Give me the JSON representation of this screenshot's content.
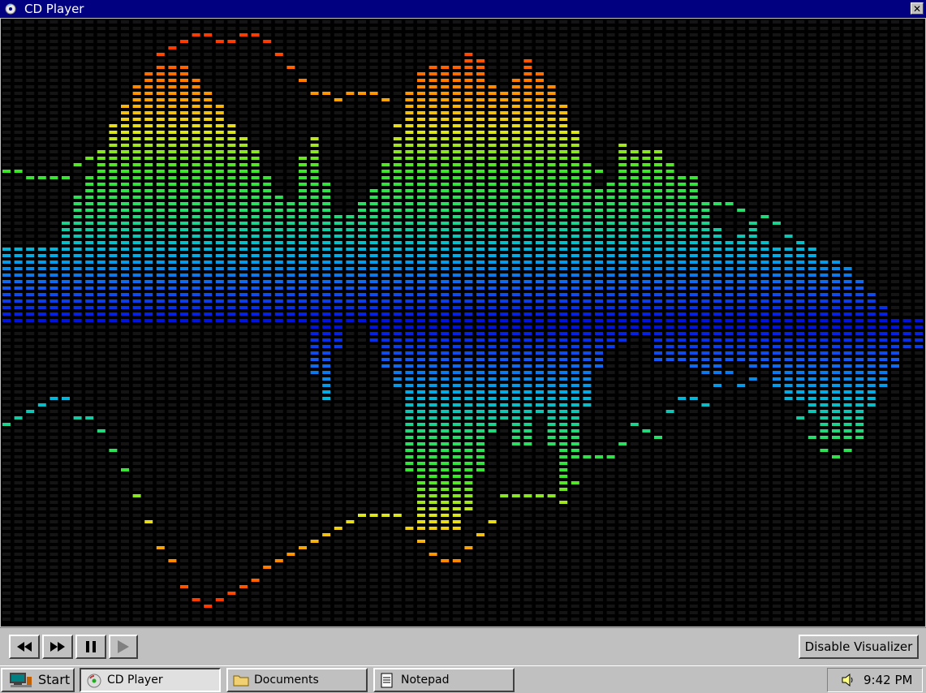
{
  "window": {
    "title": "CD Player"
  },
  "controls": {
    "disable_visualizer_label": "Disable Visualizer"
  },
  "taskbar": {
    "start_label": "Start",
    "items": [
      {
        "label": "CD Player",
        "active": true
      },
      {
        "label": "Documents",
        "active": false
      },
      {
        "label": "Notepad",
        "active": false
      }
    ],
    "clock": "9:42 PM"
  },
  "visualizer": {
    "bar_levels_up": [
      0.28,
      0.27,
      0.27,
      0.27,
      0.27,
      0.38,
      0.47,
      0.54,
      0.62,
      0.72,
      0.79,
      0.85,
      0.9,
      0.92,
      0.92,
      0.9,
      0.85,
      0.8,
      0.76,
      0.7,
      0.66,
      0.6,
      0.48,
      0.44,
      0.44,
      0.68,
      0.66,
      0.4,
      0.38,
      0.4,
      0.44,
      0.52,
      0.6,
      0.72,
      0.88,
      0.88,
      0.92,
      0.92,
      0.92,
      0.98,
      0.88,
      0.82,
      0.82,
      0.94,
      0.9,
      0.86,
      0.8,
      0.72,
      0.6,
      0.5,
      0.44,
      0.64,
      0.62,
      0.62,
      0.62,
      0.58,
      0.52,
      0.56,
      0.44,
      0.36,
      0.3,
      0.3,
      0.38,
      0.3,
      0.28,
      0.28,
      0.3,
      0.28,
      0.24,
      0.22,
      0.2,
      0.16,
      0.12,
      0.08,
      0.02,
      0.02,
      0.02
    ],
    "bar_levels_down": [
      0.0,
      0.0,
      0.0,
      0.0,
      0.0,
      0.0,
      0.0,
      0.0,
      0.0,
      0.0,
      0.0,
      0.0,
      0.0,
      0.0,
      0.0,
      0.0,
      0.0,
      0.0,
      0.0,
      0.0,
      0.0,
      0.0,
      0.0,
      0.0,
      0.0,
      0.0,
      0.28,
      0.26,
      0.0,
      0.0,
      0.0,
      0.12,
      0.2,
      0.26,
      0.72,
      0.72,
      0.72,
      0.72,
      0.72,
      0.6,
      0.42,
      0.34,
      0.36,
      0.5,
      0.34,
      0.3,
      0.6,
      0.56,
      0.34,
      0.2,
      0.08,
      0.08,
      0.06,
      0.0,
      0.14,
      0.14,
      0.14,
      0.14,
      0.18,
      0.2,
      0.14,
      0.14,
      0.16,
      0.14,
      0.22,
      0.28,
      0.26,
      0.3,
      0.42,
      0.42,
      0.42,
      0.42,
      0.3,
      0.24,
      0.16,
      0.1,
      0.1
    ],
    "peak_up": [
      0.52,
      0.52,
      0.5,
      0.5,
      0.5,
      0.5,
      0.54,
      0.56,
      0.62,
      0.68,
      0.74,
      0.8,
      0.86,
      0.94,
      0.97,
      0.99,
      1.0,
      1.0,
      0.96,
      0.99,
      1.0,
      1.0,
      0.97,
      0.92,
      0.86,
      0.82,
      0.8,
      0.78,
      0.76,
      0.8,
      0.8,
      0.78,
      0.78,
      0.62,
      0.78,
      0.82,
      0.88,
      0.92,
      0.8,
      0.84,
      0.72,
      0.66,
      0.76,
      0.78,
      0.74,
      0.7,
      0.64,
      0.54,
      0.5,
      0.52,
      0.52,
      0.48,
      0.54,
      0.52,
      0.46,
      0.42,
      0.44,
      0.44,
      0.34,
      0.4,
      0.42,
      0.38,
      0.36,
      0.36,
      0.34,
      0.3,
      0.3,
      0.28,
      0.24,
      0.22,
      0.2,
      0.16,
      0.12,
      0.08,
      0.02,
      0.02,
      0.02
    ],
    "peak_down": [
      0.34,
      0.32,
      0.3,
      0.28,
      0.26,
      0.24,
      0.32,
      0.32,
      0.36,
      0.44,
      0.52,
      0.6,
      0.7,
      0.78,
      0.84,
      0.92,
      0.96,
      0.97,
      0.96,
      0.92,
      0.9,
      0.88,
      0.84,
      0.82,
      0.78,
      0.76,
      0.74,
      0.72,
      0.7,
      0.68,
      0.66,
      0.66,
      0.66,
      0.66,
      0.72,
      0.78,
      0.82,
      0.82,
      0.8,
      0.74,
      0.72,
      0.62,
      0.58,
      0.6,
      0.6,
      0.56,
      0.64,
      0.6,
      0.48,
      0.44,
      0.46,
      0.44,
      0.34,
      0.36,
      0.4,
      0.32,
      0.26,
      0.24,
      0.3,
      0.22,
      0.16,
      0.2,
      0.18,
      0.16,
      0.2,
      0.26,
      0.32,
      0.38,
      0.44,
      0.46,
      0.44,
      0.42,
      0.3,
      0.24,
      0.16,
      0.1,
      0.1
    ]
  }
}
